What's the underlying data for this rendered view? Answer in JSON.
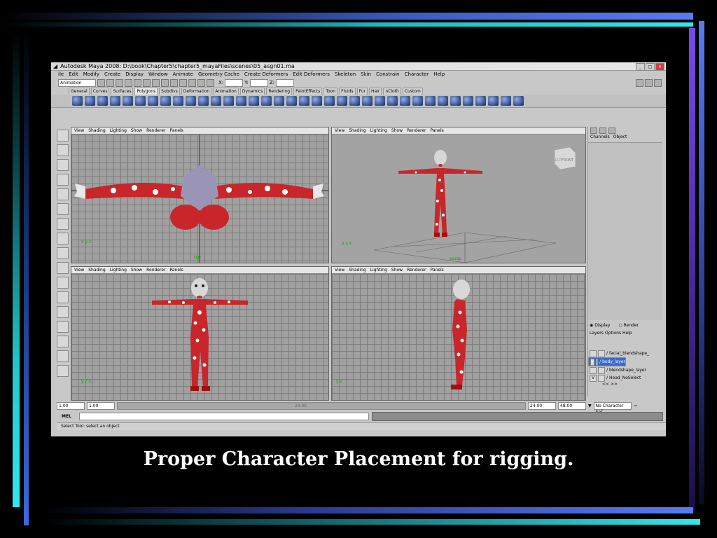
{
  "window": {
    "title": "Autodesk Maya 2008: D:\\book\\Chapter5\\chapter5_mayaFiles\\scenes\\05_asgn01.ma"
  },
  "menu": [
    "ile",
    "Edit",
    "Modify",
    "Create",
    "Display",
    "Window",
    "Animate",
    "Geometry Cache",
    "Create Deformers",
    "Edit Deformers",
    "Skeleton",
    "Skin",
    "Constrain",
    "Character",
    "Help"
  ],
  "menu_set": "Animation",
  "xyz": {
    "x": "X:",
    "y": "Y:",
    "z": "Z:"
  },
  "shelf_tabs": [
    "General",
    "Curves",
    "Surfaces",
    "Polygons",
    "Subdivs",
    "Deformation",
    "Animation",
    "Dynamics",
    "Rendering",
    "PaintEffects",
    "Toon",
    "Fluids",
    "Fur",
    "Hair",
    "nCloth",
    "Custom"
  ],
  "active_shelf_tab": "Polygons",
  "viewport_menu": [
    "View",
    "Shading",
    "Lighting",
    "Show",
    "Renderer",
    "Panels"
  ],
  "viewports": {
    "top": {
      "camera": "top"
    },
    "persp": {
      "camera": "persp",
      "viewcube": "FRONT",
      "viewcube_side": "LEFT"
    },
    "front": {
      "camera": ""
    },
    "side": {
      "camera": ""
    }
  },
  "channel_box": {
    "tabs": [
      "Channels",
      "Object"
    ]
  },
  "layer_editor": {
    "modes": [
      "Display",
      "Render"
    ],
    "menu": [
      "Layers",
      "Options",
      "Help"
    ],
    "layers": [
      {
        "v": "",
        "name": "facial_blendshape_",
        "selected": false
      },
      {
        "v": "V",
        "name": "body_layer",
        "selected": true
      },
      {
        "v": "",
        "name": "blendshape_layer",
        "selected": false
      },
      {
        "v": "V",
        "name": "Head_NoSelect",
        "selected": false
      }
    ],
    "nav": "<<    >>"
  },
  "timeline": {
    "start": "1.00",
    "current": "1.00",
    "end": "24.00",
    "range_end": "48.00",
    "char_set": "No Character Set",
    "slider_label": "24.00"
  },
  "mel": {
    "label": "MEL"
  },
  "status": "Select Tool: select an object",
  "caption": "Proper Character Placement for rigging.",
  "colors": {
    "suit": "#c8262a",
    "dots": "#ffffff",
    "head": "#9a94b6",
    "accent_blue": "#3a6acc"
  }
}
